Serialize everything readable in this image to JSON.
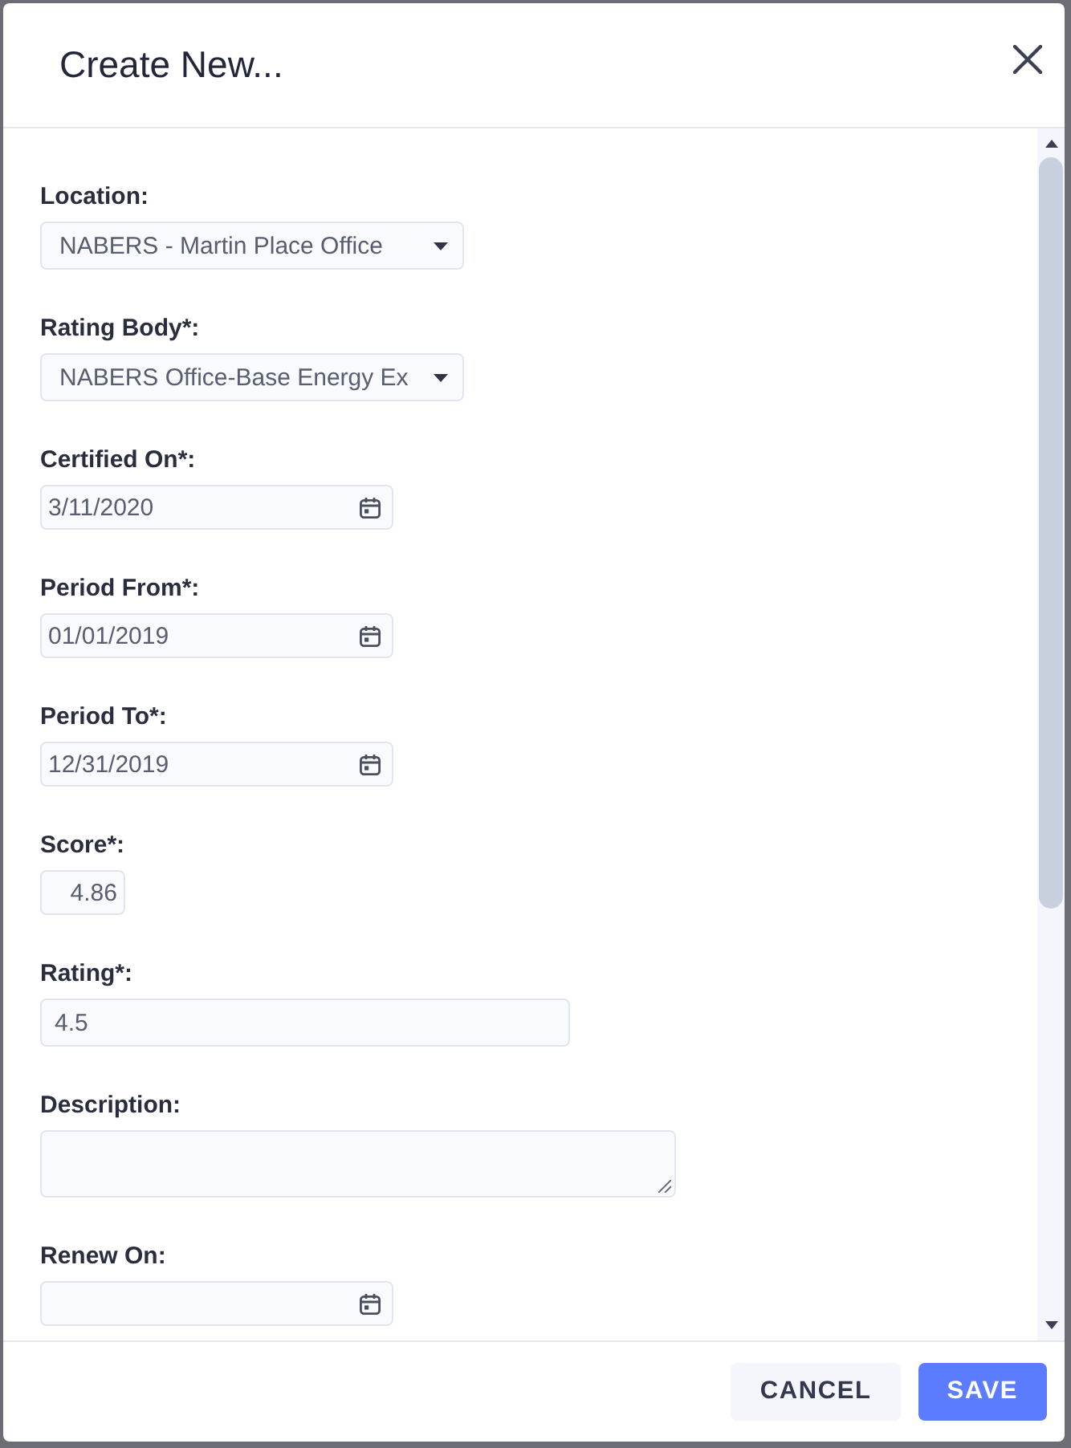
{
  "dialog": {
    "title": "Create New..."
  },
  "fields": [
    {
      "kind": "select",
      "label": "Location:",
      "value": "NABERS - Martin Place Office"
    },
    {
      "kind": "select",
      "label": "Rating Body*:",
      "value": "NABERS Office-Base Energy Ex"
    },
    {
      "kind": "date",
      "label": "Certified On*:",
      "value": "3/11/2020"
    },
    {
      "kind": "date",
      "label": "Period From*:",
      "value": "01/01/2019"
    },
    {
      "kind": "date",
      "label": "Period To*:",
      "value": "12/31/2019"
    },
    {
      "kind": "number",
      "label": "Score*:",
      "value": "4.86"
    },
    {
      "kind": "text",
      "label": "Rating*:",
      "value": "4.5"
    },
    {
      "kind": "textarea",
      "label": "Description:"
    },
    {
      "kind": "date",
      "label": "Renew On:"
    }
  ],
  "buttons": [
    {
      "kind": "secondary",
      "label": "CANCEL"
    },
    {
      "kind": "primary",
      "label": "SAVE"
    }
  ]
}
